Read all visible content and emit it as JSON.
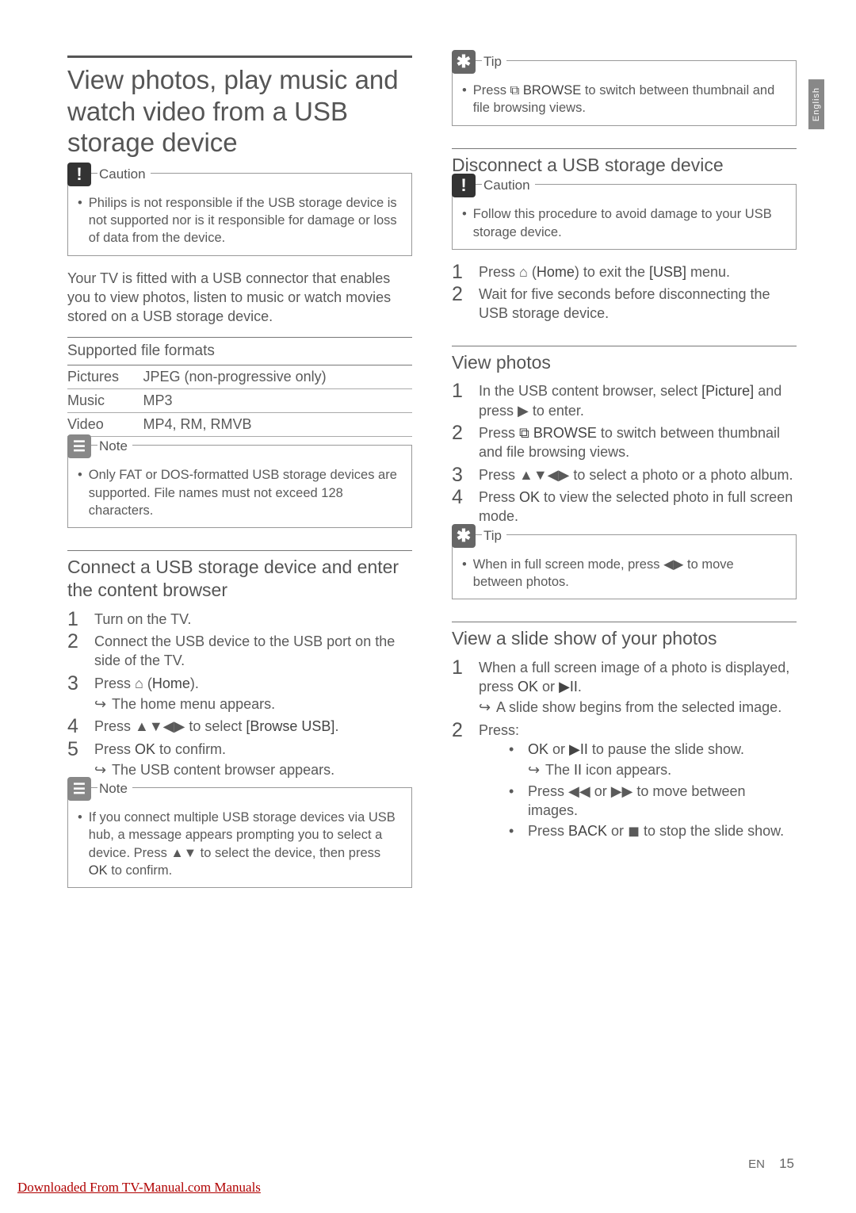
{
  "sideTab": "English",
  "left": {
    "h1": "View photos, play music and watch video from a USB storage device",
    "caution": {
      "title": "Caution",
      "body": "Philips is not responsible if the USB storage device is not supported nor is it responsible for damage or loss of data from the device."
    },
    "intro": "Your TV is fitted with a USB connector that enables you to view photos, listen to music or watch movies stored on a USB storage device.",
    "tableHeader": "Supported file formats",
    "tableRows": [
      {
        "k": "Pictures",
        "v": "JPEG (non-progressive only)"
      },
      {
        "k": "Music",
        "v": "MP3"
      },
      {
        "k": "Video",
        "v": "MP4, RM, RMVB"
      }
    ],
    "note": {
      "title": "Note",
      "body": "Only FAT or DOS-formatted USB storage devices are supported. File names must not exceed 128 characters."
    },
    "h2": "Connect a USB storage device and enter the content browser",
    "steps": {
      "s1": "Turn on the TV.",
      "s2": "Connect the USB device to the USB port on the side of the TV.",
      "s3a": "Press ",
      "s3icon": "⌂",
      "s3b": " (",
      "s3home": "Home",
      "s3c": ").",
      "s3sub": "The home menu appears.",
      "s4a": "Press ",
      "s4arrows": "▲▼◀▶",
      "s4b": " to select ",
      "s4opt": "[Browse USB]",
      "s4c": ".",
      "s5a": "Press ",
      "s5ok": "OK",
      "s5b": " to confirm.",
      "s5sub": "The USB content browser appears."
    },
    "note2": {
      "title": "Note",
      "body_a": "If you connect multiple USB storage devices via USB hub, a message appears prompting you to select a device. Press ",
      "arrows": "▲▼",
      "body_b": " to select the device, then press ",
      "ok": "OK",
      "body_c": " to confirm."
    }
  },
  "right": {
    "tip1": {
      "title": "Tip",
      "a": "Press ",
      "icon": "⧉",
      "browse": "BROWSE",
      "b": "  to switch between thumbnail and file browsing views."
    },
    "h2a": "Disconnect a USB storage device",
    "caution": {
      "title": "Caution",
      "body": "Follow this procedure to avoid damage to your USB storage device."
    },
    "disc": {
      "s1a": "Press ",
      "s1icon": "⌂",
      "s1b": " (",
      "s1home": "Home",
      "s1c": ") to exit the ",
      "s1usb": "[USB]",
      "s1d": " menu.",
      "s2": "Wait for five seconds before disconnecting the USB storage device."
    },
    "h2b": "View photos",
    "vp": {
      "s1a": "In the USB content browser, select ",
      "s1pic": "[Picture]",
      "s1b": " and press ",
      "s1play": "▶",
      "s1c": " to enter.",
      "s2a": "Press ",
      "s2icon": "⧉",
      "s2browse": "BROWSE",
      "s2b": "  to switch between thumbnail and file browsing views.",
      "s3a": "Press ",
      "s3arrows": "▲▼◀▶",
      "s3b": " to select a photo or a photo album.",
      "s4a": "Press ",
      "s4ok": "OK",
      "s4b": " to view the selected photo in full screen mode."
    },
    "tip2": {
      "title": "Tip",
      "a": "When in full screen mode, press ",
      "arrows": "◀▶",
      "b": " to move between photos."
    },
    "h2c": "View a slide show of your photos",
    "ss": {
      "s1a": "When a full screen image of a photo is displayed, press ",
      "s1ok": "OK",
      "s1or": " or ",
      "s1pp": "▶II",
      "s1c": ".",
      "s1sub": "A slide show begins from the selected image.",
      "s2": "Press:",
      "b1a": "",
      "b1ok": "OK",
      "b1or": " or ",
      "b1pp": "▶II",
      "b1b": " to pause the slide show.",
      "b1suba": "The ",
      "b1subicon": "II",
      "b1subb": " icon appears.",
      "b2a": "Press ",
      "b2rw": "◀◀",
      "b2or": " or ",
      "b2ff": "▶▶",
      "b2b": " to move between images.",
      "b3a": "Press ",
      "b3back": "BACK",
      "b3or": " or ",
      "b3stop": "◼",
      "b3b": " to stop the slide show."
    }
  },
  "footer": {
    "lang": "EN",
    "page": "15"
  },
  "download": "Downloaded From TV-Manual.com Manuals"
}
